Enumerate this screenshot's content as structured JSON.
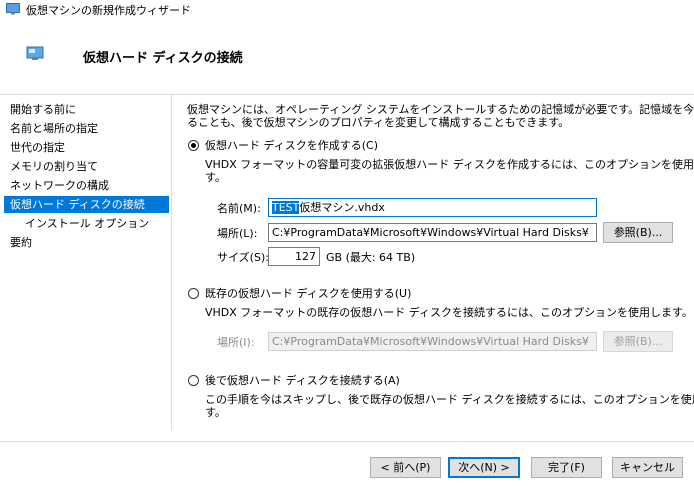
{
  "window": {
    "title": "仮想マシンの新規作成ウィザード"
  },
  "header": {
    "title": "仮想ハード ディスクの接続",
    "icon": "monitor-icon"
  },
  "sidebar": {
    "items": [
      {
        "label": "開始する前に"
      },
      {
        "label": "名前と場所の指定"
      },
      {
        "label": "世代の指定"
      },
      {
        "label": "メモリの割り当て"
      },
      {
        "label": "ネットワークの構成"
      },
      {
        "label": "仮想ハード ディスクの接続",
        "selected": true
      },
      {
        "label": "インストール オプション"
      },
      {
        "label": "要約"
      }
    ]
  },
  "main": {
    "intro_line1": "仮想マシンには、オペレーティング システムをインストールするための記憶域が必要です。記憶域を今指定す",
    "intro_line2": "ることも、後で仮想マシンのプロパティを変更して構成することもできます。",
    "option_create": {
      "label": "仮想ハード ディスクを作成する(C)",
      "checked": true,
      "desc_line1": "VHDX フォーマットの容量可変の拡張仮想ハード ディスクを作成するには、このオプションを使用しま",
      "desc_line2": "す。",
      "name_label": "名前(M):",
      "name_selected": "TEST",
      "name_rest": "仮想マシン.vhdx",
      "location_label": "場所(L):",
      "location_value": "C:¥ProgramData¥Microsoft¥Windows¥Virtual Hard Disks¥",
      "browse_label": "参照(B)...",
      "size_label": "サイズ(S):",
      "size_value": "127",
      "size_unit": "GB (最大: 64 TB)"
    },
    "option_existing": {
      "label": "既存の仮想ハード ディスクを使用する(U)",
      "checked": false,
      "desc": "VHDX フォーマットの既存の仮想ハード ディスクを接続するには、このオプションを使用します。",
      "location_label": "場所(I):",
      "location_value": "C:¥ProgramData¥Microsoft¥Windows¥Virtual Hard Disks¥",
      "browse_label": "参照(B)..."
    },
    "option_later": {
      "label": "後で仮想ハード ディスクを接続する(A)",
      "checked": false,
      "desc_line1": "この手順を今はスキップし、後で既存の仮想ハード ディスクを接続するには、このオプションを使用しま",
      "desc_line2": "す。"
    }
  },
  "footer": {
    "back": "< 前へ(P)",
    "next": "次へ(N) >",
    "finish": "完了(F)",
    "cancel": "キャンセル"
  },
  "colors": {
    "accent": "#0078d7"
  }
}
